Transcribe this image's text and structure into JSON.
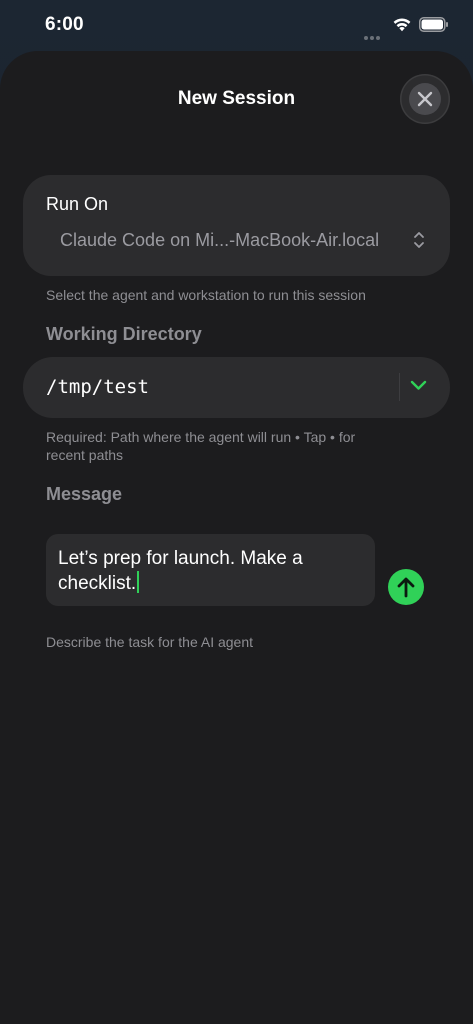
{
  "status_bar": {
    "time": "6:00"
  },
  "sheet": {
    "title": "New Session"
  },
  "run_on": {
    "label": "Run On",
    "value": "Claude Code on Mi...-MacBook-Air.local",
    "helper": "Select the agent and workstation to run this session"
  },
  "working_directory": {
    "header": "Working Directory",
    "value": "/tmp/test",
    "helper_line1": "Required: Path where the agent will run • Tap • for",
    "helper_line2": "recent paths"
  },
  "message": {
    "header": "Message",
    "line1": "Let’s prep for launch. Make a",
    "line2": "checklist.",
    "helper": "Describe the task for the AI agent"
  },
  "colors": {
    "accent": "#30d158",
    "sheet_bg": "#1c1c1e",
    "card_bg": "#2c2c2e",
    "secondary_text": "#8e8e93"
  }
}
